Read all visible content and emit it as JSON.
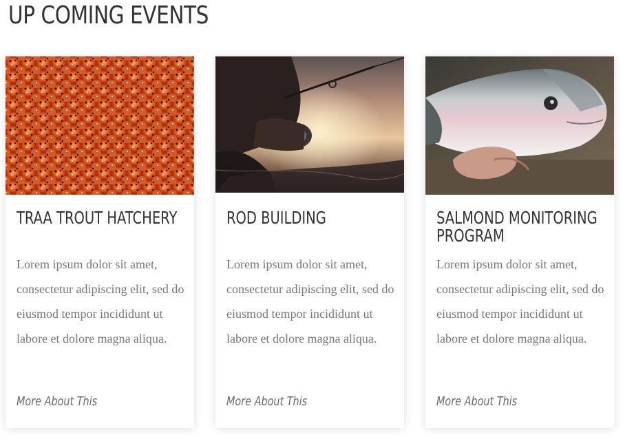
{
  "section": {
    "title": "UP COMING EVENTS"
  },
  "events": [
    {
      "title": "TRAA TROUT HATCHERY",
      "image": "fish-eggs-photo",
      "description": "Lorem ipsum dolor sit amet, consectetur adipiscing elit, sed do eiusmod tempor incididunt ut labore et dolore magna aliqua.",
      "link_label": "More About This"
    },
    {
      "title": "ROD BUILDING",
      "image": "fishing-rod-sunset-photo",
      "description": "Lorem ipsum dolor sit amet, consectetur adipiscing elit, sed do eiusmod tempor incididunt ut labore et dolore magna aliqua.",
      "link_label": "More About This"
    },
    {
      "title": "SALMOND MONITORING PROGRAM",
      "image": "salmon-in-hand-photo",
      "description": "Lorem ipsum dolor sit amet, consectetur adipiscing elit, sed do eiusmod tempor incididunt ut labore et dolore magna aliqua.",
      "link_label": "More About This"
    }
  ]
}
